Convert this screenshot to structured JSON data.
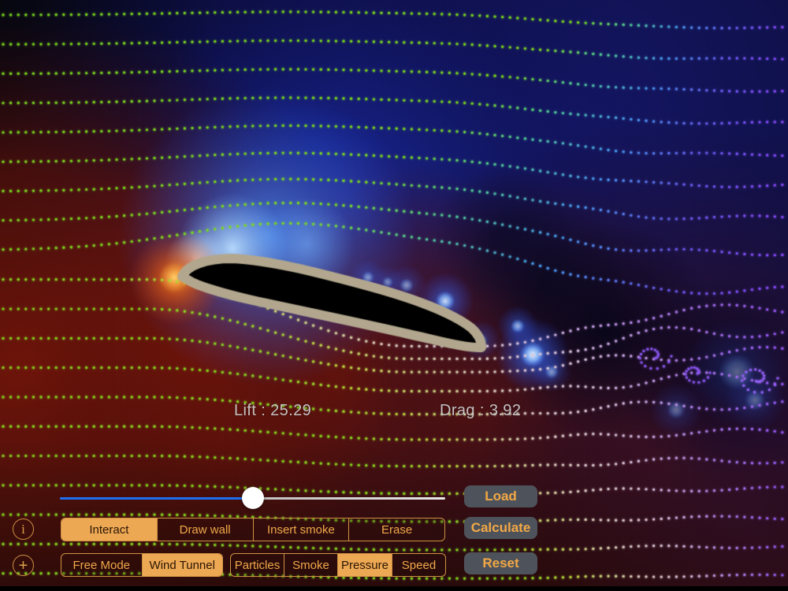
{
  "readouts": {
    "lift": "Lift : 25.29",
    "drag": "Drag : 3.92"
  },
  "actions": {
    "load": "Load",
    "calculate": "Calculate",
    "reset": "Reset"
  },
  "icons": {
    "info": "i",
    "add": "+"
  },
  "slider": {
    "value_pct": 50
  },
  "tool_tabs": {
    "items": [
      "Interact",
      "Draw wall",
      "Insert smoke",
      "Erase"
    ],
    "selected": "Interact"
  },
  "mode_tabs": {
    "items": [
      "Free Mode",
      "Wind Tunnel"
    ],
    "selected": "Wind Tunnel"
  },
  "view_tabs": {
    "items": [
      "Particles",
      "Smoke",
      "Pressure",
      "Speed"
    ],
    "selected": "Pressure"
  },
  "colors": {
    "accent_orange": "#efa64f",
    "tab_text": "#efa94a",
    "tab_border": "#cf9242",
    "selected_tab_bg": "#eda854",
    "selected_tab_text": "#2a1504",
    "button_bg": "#4e535b",
    "button_text": "#f3a845",
    "slider_fill": "#1e6ef2",
    "readout_text": "#d3d2d2",
    "dot_green": "#7ad81e",
    "dot_purple": "#8a48ff",
    "airfoil_fill": "#000000",
    "airfoil_outline": "#b2a78e",
    "glow_orange": "#ff8c1a",
    "field_red": "#781609",
    "field_blue": "#14186e",
    "bloom_blue": "#9ecbff"
  }
}
